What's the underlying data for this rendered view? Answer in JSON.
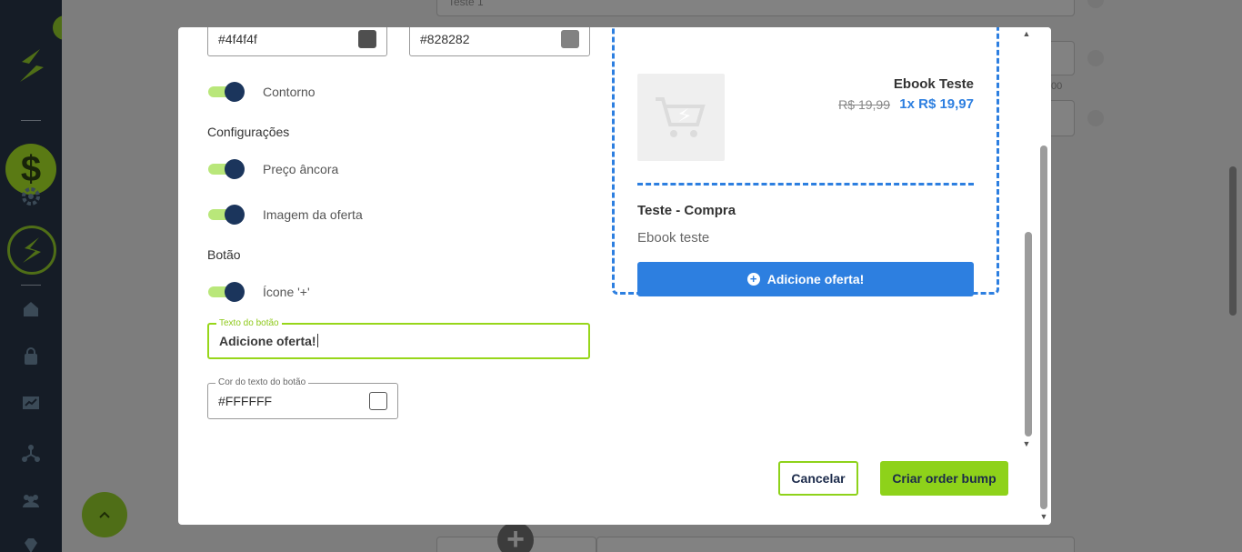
{
  "background": {
    "field_text_top": "Teste 1",
    "field_text_suffix": "00"
  },
  "form": {
    "color_field_1": {
      "value": "#4f4f4f",
      "swatch_color": "#4f4f4f"
    },
    "color_field_2": {
      "value": "#828282",
      "swatch_color": "#828282"
    },
    "toggle_contorno": {
      "label": "Contorno",
      "on": true
    },
    "section_config": "Configurações",
    "toggle_preco": {
      "label": "Preço âncora",
      "on": true
    },
    "toggle_imagem": {
      "label": "Imagem da oferta",
      "on": true
    },
    "section_botao": "Botão",
    "toggle_icone": {
      "label": "Ícone '+'",
      "on": true
    },
    "button_text_field": {
      "legend": "Texto do botão",
      "value": "Adicione oferta!"
    },
    "button_color_field": {
      "legend": "Cor do texto do botão",
      "value": "#FFFFFF",
      "swatch_color": "#FFFFFF"
    }
  },
  "preview": {
    "product_name": "Ebook Teste",
    "old_price": "R$ 19,99",
    "new_price": "1x R$ 19,97",
    "offer_title": "Teste - Compra",
    "offer_description": "Ebook teste",
    "offer_button": "Adicione oferta!",
    "accent_color": "#2d7fe0"
  },
  "actions": {
    "cancel": "Cancelar",
    "create": "Criar order bump"
  },
  "colors": {
    "brand_green": "#8ed21a",
    "navy": "#1b355c"
  }
}
